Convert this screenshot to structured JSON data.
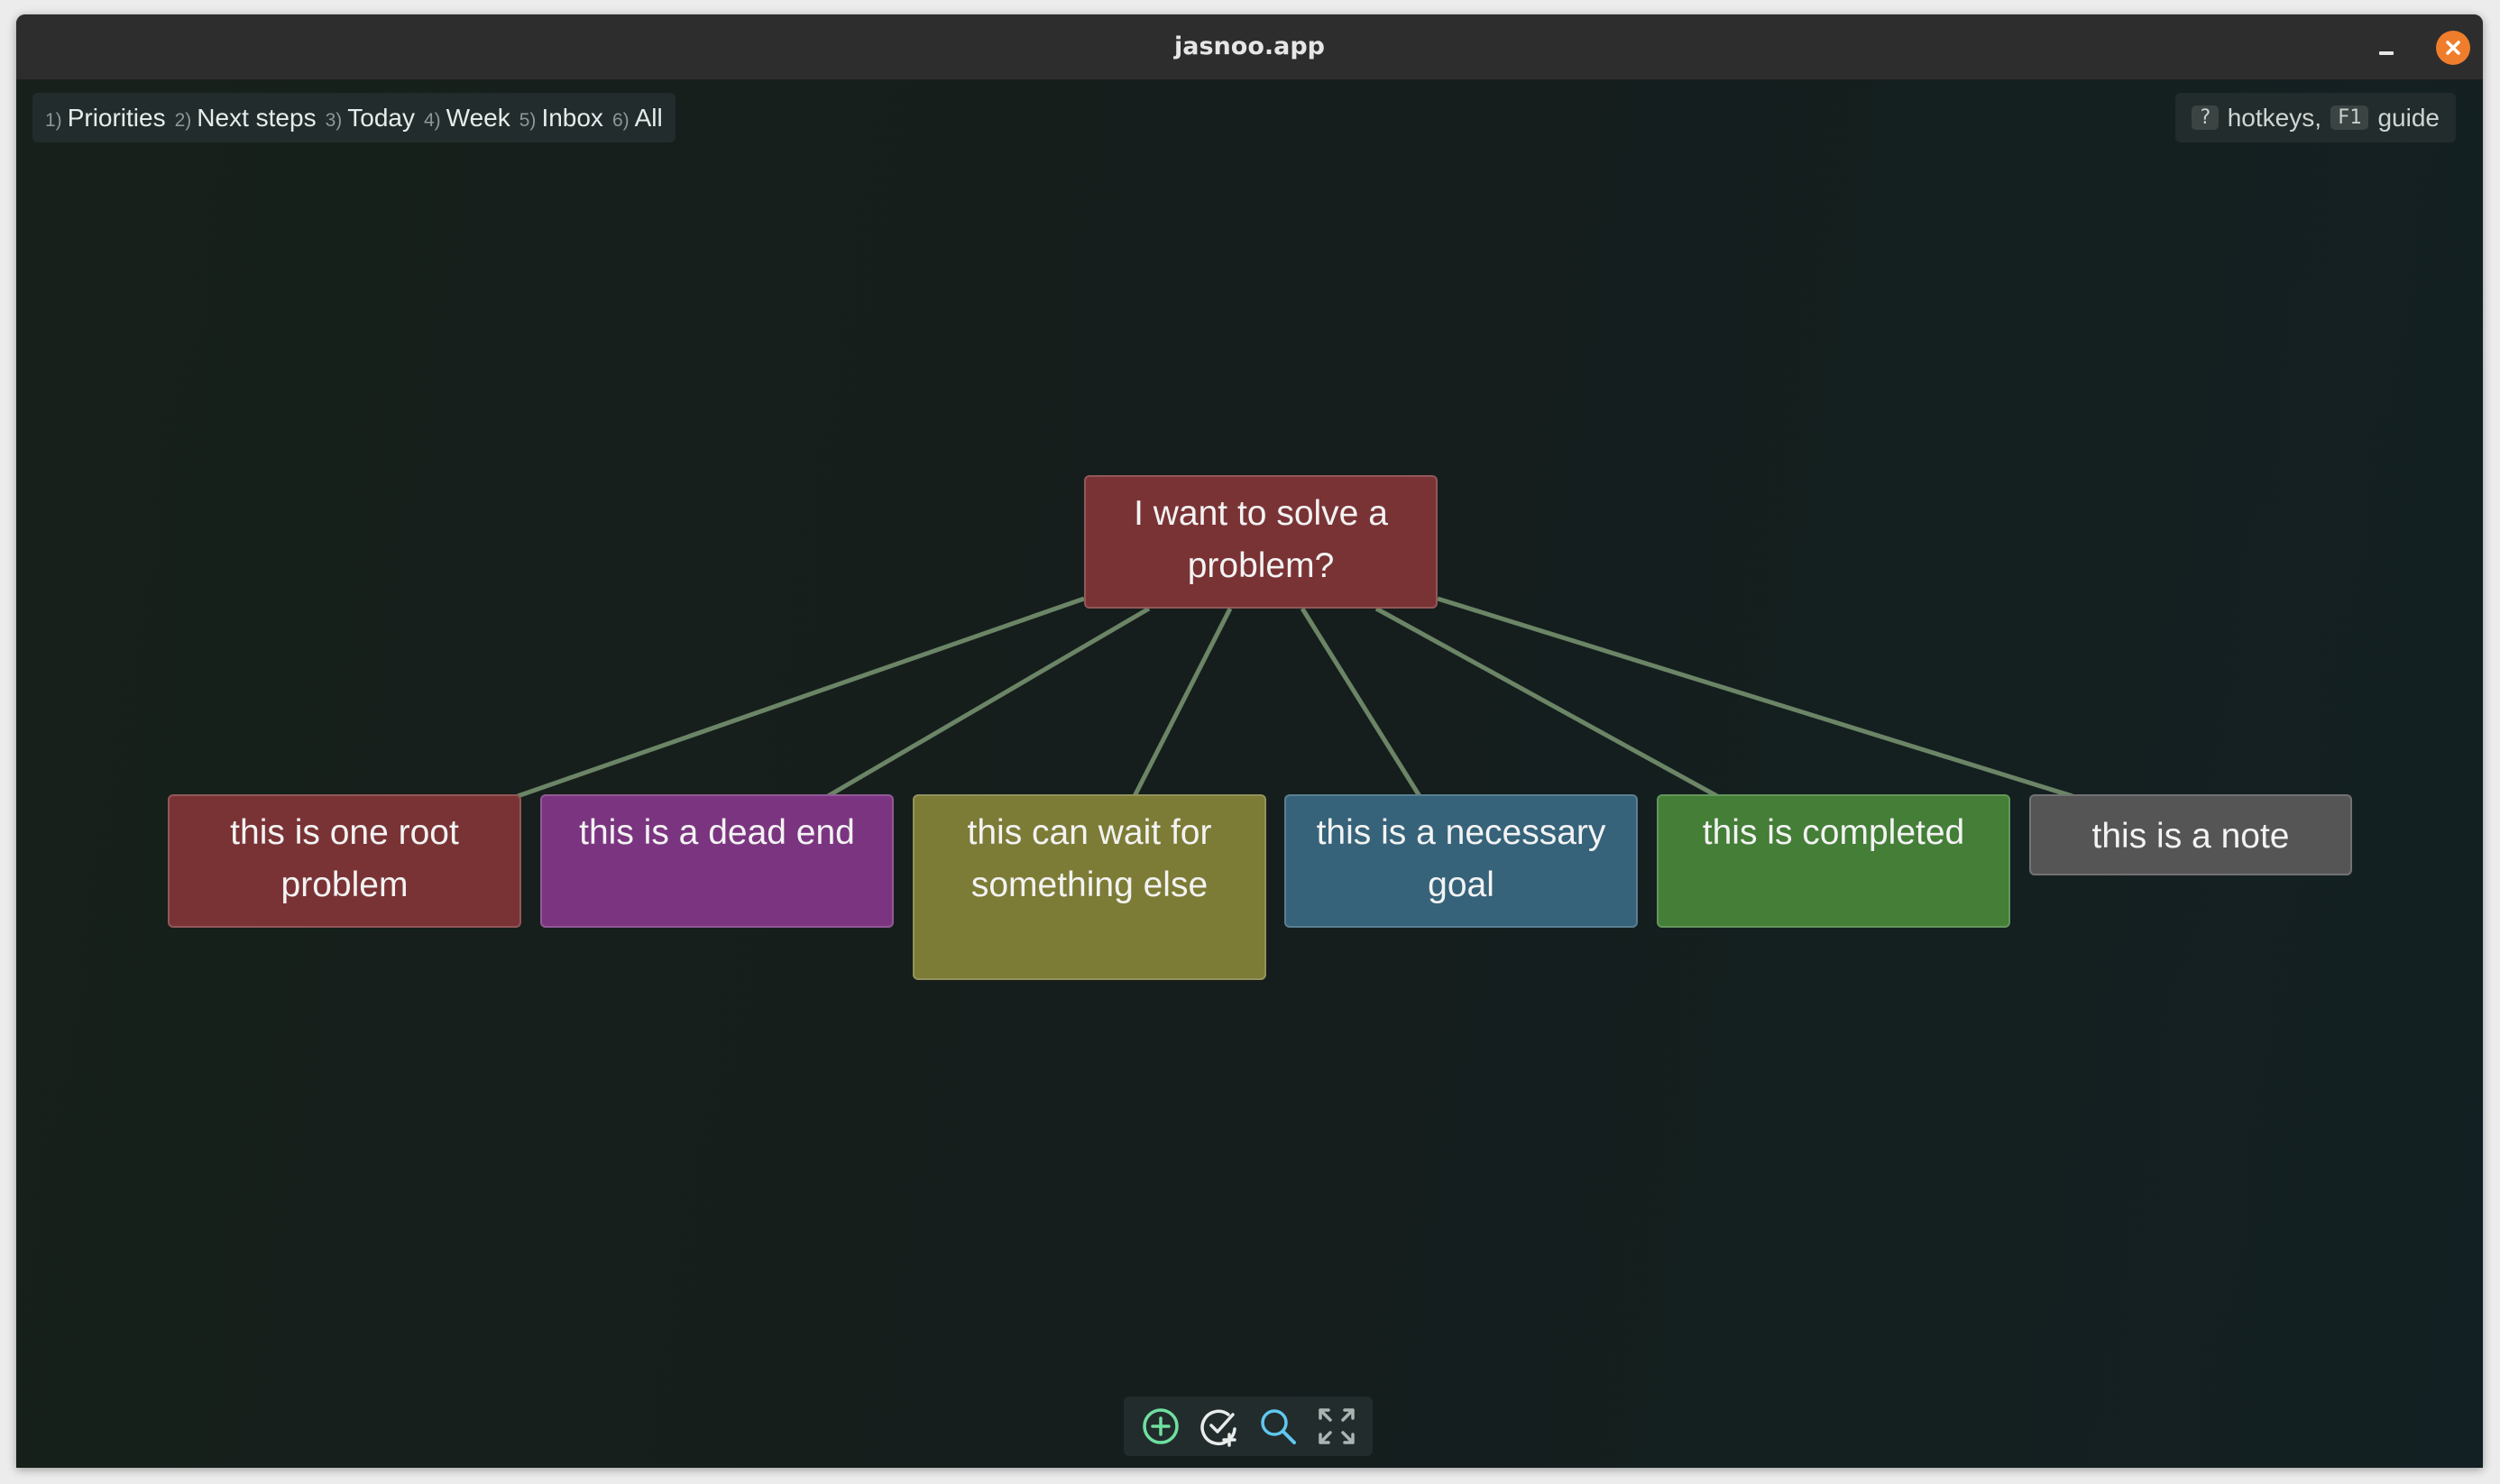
{
  "window": {
    "title": "jasnoo.app"
  },
  "tabs": [
    {
      "num": "1)",
      "label": "Priorities"
    },
    {
      "num": "2)",
      "label": "Next steps"
    },
    {
      "num": "3)",
      "label": "Today"
    },
    {
      "num": "4)",
      "label": "Week"
    },
    {
      "num": "5)",
      "label": "Inbox"
    },
    {
      "num": "6)",
      "label": "All"
    }
  ],
  "help": {
    "key1": "?",
    "text1": "hotkeys,",
    "key2": "F1",
    "text2": "guide"
  },
  "graph": {
    "root": {
      "text": "I want to solve a problem?",
      "color": "#7a3335"
    },
    "children": [
      {
        "text": "this is one root problem",
        "color": "#7a3335"
      },
      {
        "text": "this is a dead end",
        "color": "#7b3580"
      },
      {
        "text": "this can wait for something else",
        "color": "#7c7c37"
      },
      {
        "text": "this is a necessary goal",
        "color": "#36637a"
      },
      {
        "text": "this is completed",
        "color": "#447e37"
      },
      {
        "text": "this is a note",
        "color": "#555555"
      }
    ],
    "edge_color": "#6b8566"
  },
  "toolbar": [
    {
      "name": "add-node-button",
      "icon": "plus-circle-icon"
    },
    {
      "name": "add-task-button",
      "icon": "check-plus-icon"
    },
    {
      "name": "search-button",
      "icon": "search-icon"
    },
    {
      "name": "fit-view-button",
      "icon": "expand-icon"
    }
  ]
}
